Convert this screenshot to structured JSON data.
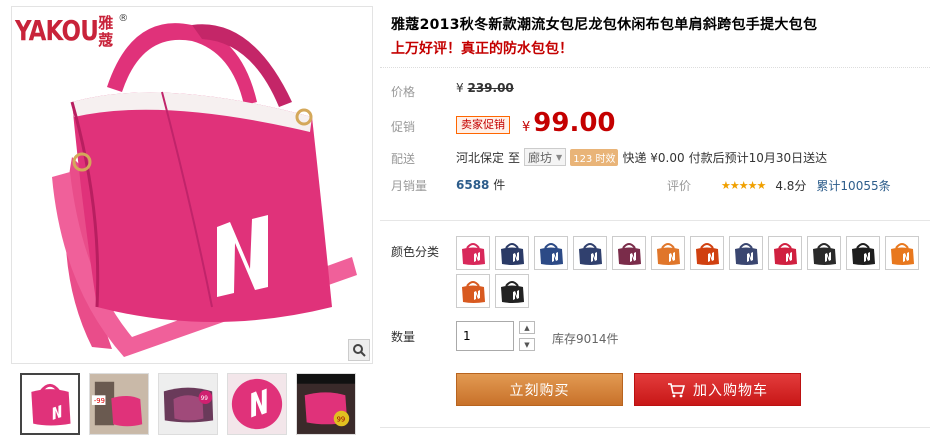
{
  "brand": {
    "latin": "YAKOU",
    "chinese": "雅蔻",
    "reg": "®"
  },
  "product": {
    "title": "雅蔻2013秋冬新款潮流女包尼龙包休闲布包单肩斜跨包手提大包包",
    "subtitle": "上万好评！真正的防水包包！"
  },
  "price": {
    "label": "价格",
    "currency": "¥",
    "original": "239.00"
  },
  "promo": {
    "label": "促销",
    "badge": "卖家促销",
    "currency": "¥",
    "value": "99.00"
  },
  "shipping": {
    "label": "配送",
    "from": "河北保定",
    "to_word": "至",
    "destination": "廊坊",
    "time_badge": "123 时效",
    "method": "快递 ¥0.00",
    "estimate": "付款后预计10月30日送达"
  },
  "sales": {
    "label": "月销量",
    "count": "6588",
    "unit": "件"
  },
  "rating": {
    "label": "评价",
    "stars": "★★★★★",
    "score": "4.8分",
    "total": "累计10055条"
  },
  "color": {
    "label": "颜色分类",
    "swatches": [
      "#d8285a",
      "#2a3a66",
      "#2c4a86",
      "#30406e",
      "#7a2c4a",
      "#e0762a",
      "#d04010",
      "#3a4670",
      "#d02040",
      "#2a2a2a",
      "#1e1e1e",
      "#e8781e",
      "#d85a20",
      "#222222"
    ]
  },
  "quantity": {
    "label": "数量",
    "value": "1",
    "stock": "库存9014件"
  },
  "buttons": {
    "buy": "立刻购买",
    "cart": "加入购物车"
  },
  "colors": {
    "accent": "#c40000",
    "buy_button": "#d4823a",
    "cart_button": "#d42020",
    "bag": "#e0327a"
  }
}
